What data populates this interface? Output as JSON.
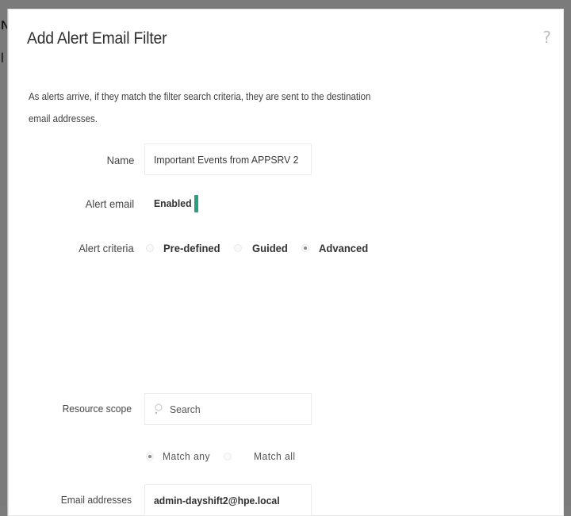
{
  "dialog": {
    "title": "Add Alert Email Filter",
    "help_icon": "?",
    "description": "As  alerts arrive, if they match the filter search criteria, they are sent to the destination email addresses."
  },
  "form": {
    "name": {
      "label": "Name",
      "value": "Important Events from APPSRV 2"
    },
    "alert_email": {
      "label": "Alert email",
      "state": "Enabled",
      "toggle_color": "#2d9e7d"
    },
    "alert_criteria": {
      "label": "Alert criteria",
      "options": [
        {
          "label": "Pre-defined",
          "selected": false
        },
        {
          "label": "Guided",
          "selected": false
        },
        {
          "label": "Advanced",
          "selected": true
        }
      ]
    },
    "resource_scope": {
      "label": "Resource scope",
      "placeholder": "Search",
      "match_options": [
        {
          "label": "Match any",
          "selected": true
        },
        {
          "label": "Match all",
          "selected": false
        }
      ]
    },
    "email_addresses": {
      "label": "Email addresses",
      "value": "admin-dayshift2@hpe.local"
    }
  }
}
